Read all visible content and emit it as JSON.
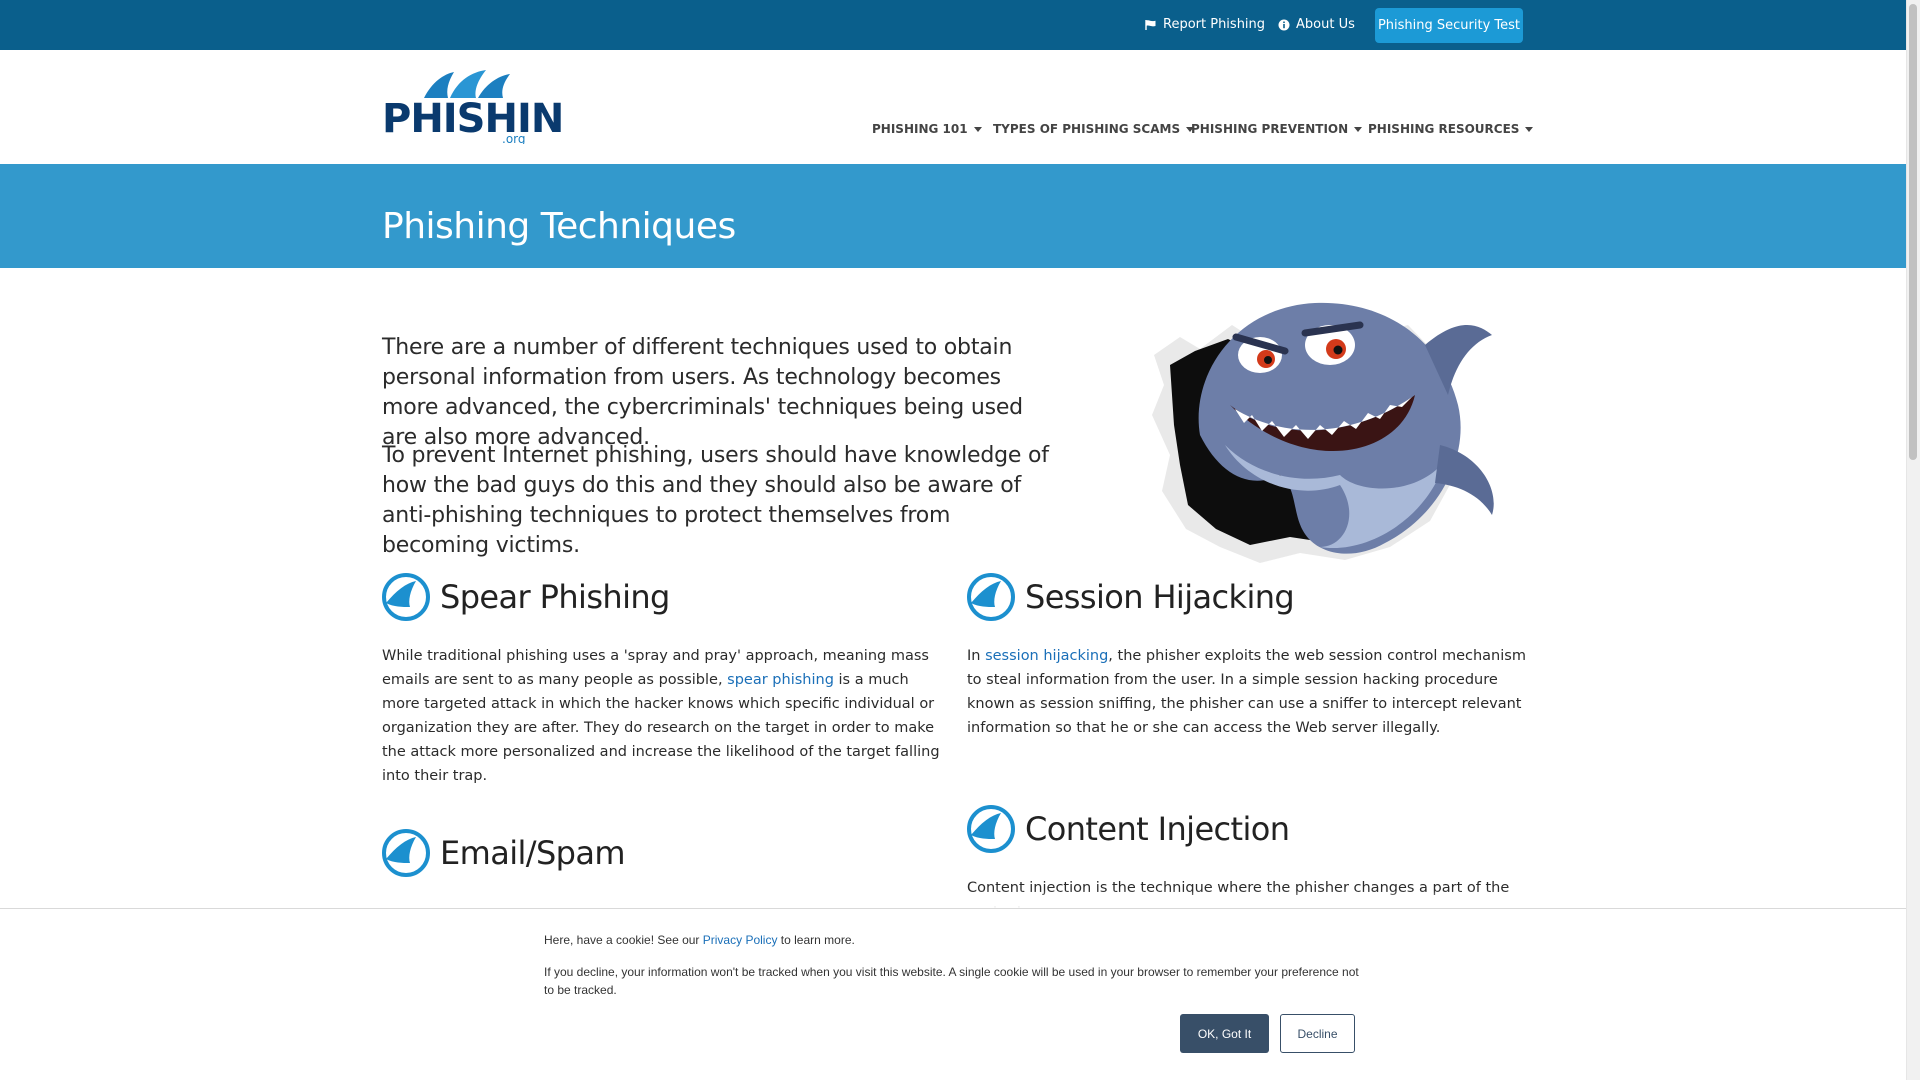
{
  "topbar": {
    "report_label": "Report Phishing",
    "report_icon": "flag-icon",
    "about_label": "About Us",
    "about_icon": "info-icon",
    "test_button": "Phishing Security Test"
  },
  "logo": {
    "text": "PHISHING",
    "suffix": ".org"
  },
  "nav": {
    "items": [
      {
        "label": "PHISHING 101"
      },
      {
        "label": "TYPES OF PHISHING SCAMS"
      },
      {
        "label": "PHISHING PREVENTION"
      },
      {
        "label": "PHISHING RESOURCES"
      }
    ]
  },
  "banner": {
    "title": "Phishing Techniques"
  },
  "intro": {
    "p1": "There are a number of different techniques used to obtain personal information from users. As technology becomes more advanced, the cybercriminals' techniques being used are also more advanced.",
    "p2": "To prevent Internet phishing, users should have knowledge of how the bad guys do this and they should also be aware of anti-phishing techniques to protect themselves from becoming victims."
  },
  "sections": {
    "spear": {
      "title": "Spear Phishing",
      "before": "While traditional phishing uses a 'spray and pray' approach, meaning mass emails are sent to as many people as possible, ",
      "link": "spear phishing",
      "after": " is a much more targeted attack in which the hacker knows which specific individual or organization they are after. They do research on the target in order to make the attack more personalized and increase the likelihood of the target falling into their trap."
    },
    "session": {
      "title": "Session Hijacking",
      "before": "In ",
      "link": "session hijacking",
      "after": ", the phisher exploits the web session control mechanism to steal information from the user. In a simple session hacking procedure known as session sniffing, the phisher can use a sniffer to intercept relevant information so that he or she can access the Web server illegally."
    },
    "email": {
      "title": "Email/Spam"
    },
    "content": {
      "title": "Content Injection",
      "body": "Content injection is the technique where the phisher changes a part of the content"
    }
  },
  "cookie": {
    "line1_before": "Here, have a cookie! See our ",
    "line1_link": "Privacy Policy",
    "line1_after": " to learn more.",
    "line2": "If you decline, your information won't be tracked when you visit this website. A single cookie will be used in your browser to remember your preference not to be tracked.",
    "ok_label": "OK, Got It",
    "decline_label": "Decline"
  }
}
